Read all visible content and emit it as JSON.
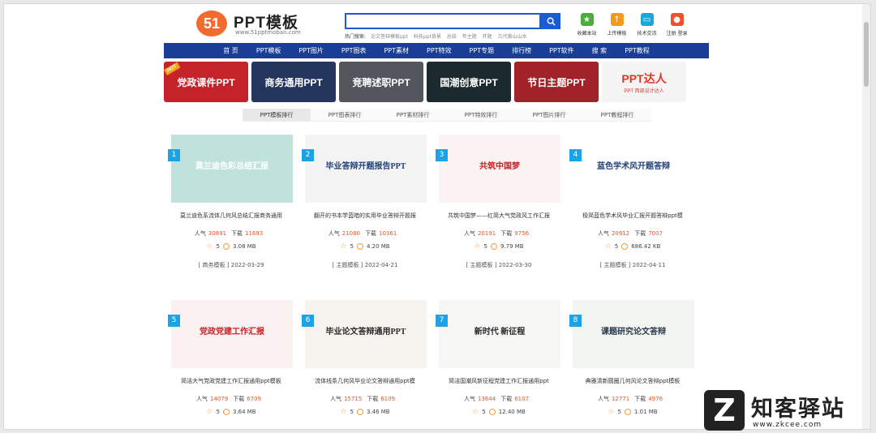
{
  "header": {
    "logo_text": "51",
    "site_name": "PPT模板",
    "site_url": "www.51pptmoban.com",
    "hot_label": "热门搜索:",
    "hot_searches": [
      "论文答辩模板ppt",
      "科技ppt背景",
      "总结",
      "年主题",
      "开题",
      "古代黄山山水"
    ],
    "tools": [
      {
        "label": "收藏本站",
        "icon": "star-icon",
        "color": "#4cae3a"
      },
      {
        "label": "上传模板",
        "icon": "upload-icon",
        "color": "#f29a1a"
      },
      {
        "label": "技术交流",
        "icon": "chat-icon",
        "color": "#1aa8d8"
      },
      {
        "label": "注册 登录",
        "icon": "user-icon",
        "color": "#e9542d"
      }
    ]
  },
  "nav": [
    "首 页",
    "PPT模板",
    "PPT图片",
    "PPT图表",
    "PPT素材",
    "PPT特效",
    "PPT专题",
    "排行榜",
    "PPT软件",
    "搜 索",
    "PPT教程"
  ],
  "banners": [
    {
      "label": "党政课件PPT",
      "color": "#c4232a",
      "hot": "HOT"
    },
    {
      "label": "商务通用PPT",
      "color": "#24365e"
    },
    {
      "label": "竞聘述职PPT",
      "color": "#54565e"
    },
    {
      "label": "国潮创意PPT",
      "color": "#1a2a2e"
    },
    {
      "label": "节日主题PPT",
      "color": "#a12228"
    },
    {
      "label": "PPT达人",
      "color": "#f4f4f4",
      "sub": "PPT 西部设计达人"
    }
  ],
  "tabs": [
    "PPT模板排行",
    "PPT图表排行",
    "PPT素材排行",
    "PPT特效排行",
    "PPT图片排行",
    "PPT教程排行"
  ],
  "labels": {
    "popularity": "人气",
    "downloads": "下载"
  },
  "items": [
    {
      "rank": "1",
      "thumb_title": "莫兰迪色彩总结汇报",
      "thumb_bg": "#bfe2dc",
      "thumb_fg": "#ffffff",
      "name": "莫兰迪色系流体几何风总结汇报商务通用",
      "pop": "30891",
      "down": "11693",
      "stars": "5",
      "size": "3.08 MB",
      "category": "[ 商务模板 ]",
      "date": "2022-03-29"
    },
    {
      "rank": "2",
      "thumb_title": "毕业答辩开题报告PPT",
      "thumb_bg": "#f3f3f3",
      "thumb_fg": "#24427a",
      "name": "翻开的书本学蓝暗的实用毕业答辩开题报",
      "pop": "21080",
      "down": "10361",
      "stars": "5",
      "size": "4.20 MB",
      "category": "[ 主题模板 ]",
      "date": "2022-04-21"
    },
    {
      "rank": "3",
      "thumb_title": "共筑中国梦",
      "thumb_bg": "#fbf3f1",
      "thumb_fg": "#c4232a",
      "name": "共筑中国梦——红简大气党政风工作汇报",
      "pop": "20191",
      "down": "9756",
      "stars": "5",
      "size": "9.79 MB",
      "category": "[ 主题模板 ]",
      "date": "2022-03-30"
    },
    {
      "rank": "4",
      "thumb_title": "蓝色学术风开题答辩",
      "thumb_bg": "#ffffff",
      "thumb_fg": "#24427a",
      "name": "极简蓝色学术风毕业汇报开题答辩ppt模",
      "pop": "20912",
      "down": "7007",
      "stars": "5",
      "size": "686.42 KB",
      "category": "[ 主题模板 ]",
      "date": "2022-04-11"
    },
    {
      "rank": "5",
      "thumb_title": "党政党建工作汇报",
      "thumb_bg": "#fbf1f1",
      "thumb_fg": "#c4232a",
      "name": "简洁大气党政党建工作汇报通用ppt模板",
      "pop": "14079",
      "down": "6709",
      "stars": "5",
      "size": "3.64 MB",
      "category": "",
      "date": ""
    },
    {
      "rank": "6",
      "thumb_title": "毕业论文答辩通用PPT",
      "thumb_bg": "#f6f3ee",
      "thumb_fg": "#2a2a2a",
      "name": "流体线条几何风毕业论文答辩通用ppt模",
      "pop": "15715",
      "down": "6109",
      "stars": "5",
      "size": "3.46 MB",
      "category": "",
      "date": ""
    },
    {
      "rank": "7",
      "thumb_title": "新时代 新征程",
      "thumb_bg": "#f6f7f5",
      "thumb_fg": "#2a2a2a",
      "name": "简洁国潮风新征程党建工作汇报通用ppt",
      "pop": "13644",
      "down": "6107",
      "stars": "5",
      "size": "12.40 MB",
      "category": "",
      "date": ""
    },
    {
      "rank": "8",
      "thumb_title": "课题研究论文答辩",
      "thumb_bg": "#f3f5f2",
      "thumb_fg": "#2a3a4a",
      "name": "典雅清新圆圈几何风论文答辩ppt模板",
      "pop": "12771",
      "down": "4976",
      "stars": "5",
      "size": "1.01 MB",
      "category": "",
      "date": ""
    }
  ],
  "watermark": {
    "box": "Z",
    "text": "知客驿站",
    "url": "www.zkcee.com"
  }
}
